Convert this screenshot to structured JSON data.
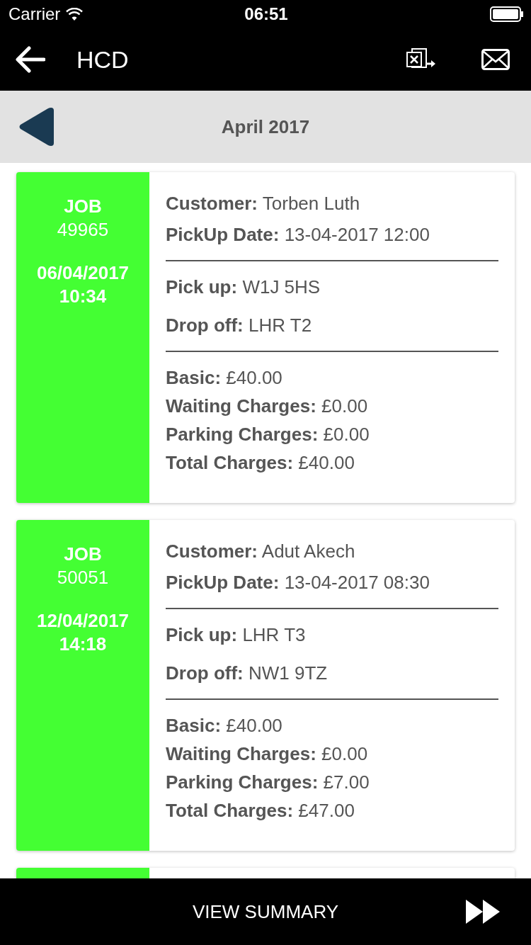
{
  "status_bar": {
    "carrier": "Carrier",
    "time": "06:51"
  },
  "nav_bar": {
    "title": "HCD"
  },
  "month_bar": {
    "title": "April 2017"
  },
  "jobs": [
    {
      "heading": "JOB",
      "number": "49965",
      "date": "06/04/2017",
      "time": "10:34",
      "groups": [
        [
          {
            "label": "Customer:",
            "value": "Torben Luth"
          },
          {
            "label": "PickUp Date:",
            "value": "13-04-2017 12:00"
          }
        ],
        [
          {
            "label": "Pick up:",
            "value": "W1J 5HS"
          },
          {
            "label": "Drop off:",
            "value": "LHR T2"
          }
        ],
        [
          {
            "label": "Basic:",
            "value": "£40.00"
          },
          {
            "label": "Waiting Charges:",
            "value": "£0.00"
          },
          {
            "label": "Parking Charges:",
            "value": "£0.00"
          },
          {
            "label": "Total Charges:",
            "value": "£40.00"
          }
        ]
      ]
    },
    {
      "heading": "JOB",
      "number": "50051",
      "date": "12/04/2017",
      "time": "14:18",
      "groups": [
        [
          {
            "label": "Customer:",
            "value": "Adut Akech"
          },
          {
            "label": "PickUp Date:",
            "value": "13-04-2017 08:30"
          }
        ],
        [
          {
            "label": "Pick up:",
            "value": "LHR T3"
          },
          {
            "label": "Drop off:",
            "value": "NW1 9TZ"
          }
        ],
        [
          {
            "label": "Basic:",
            "value": "£40.00"
          },
          {
            "label": "Waiting Charges:",
            "value": "£0.00"
          },
          {
            "label": "Parking Charges:",
            "value": "£7.00"
          },
          {
            "label": "Total Charges:",
            "value": "£47.00"
          }
        ]
      ]
    }
  ],
  "footer": {
    "label": "VIEW SUMMARY"
  }
}
